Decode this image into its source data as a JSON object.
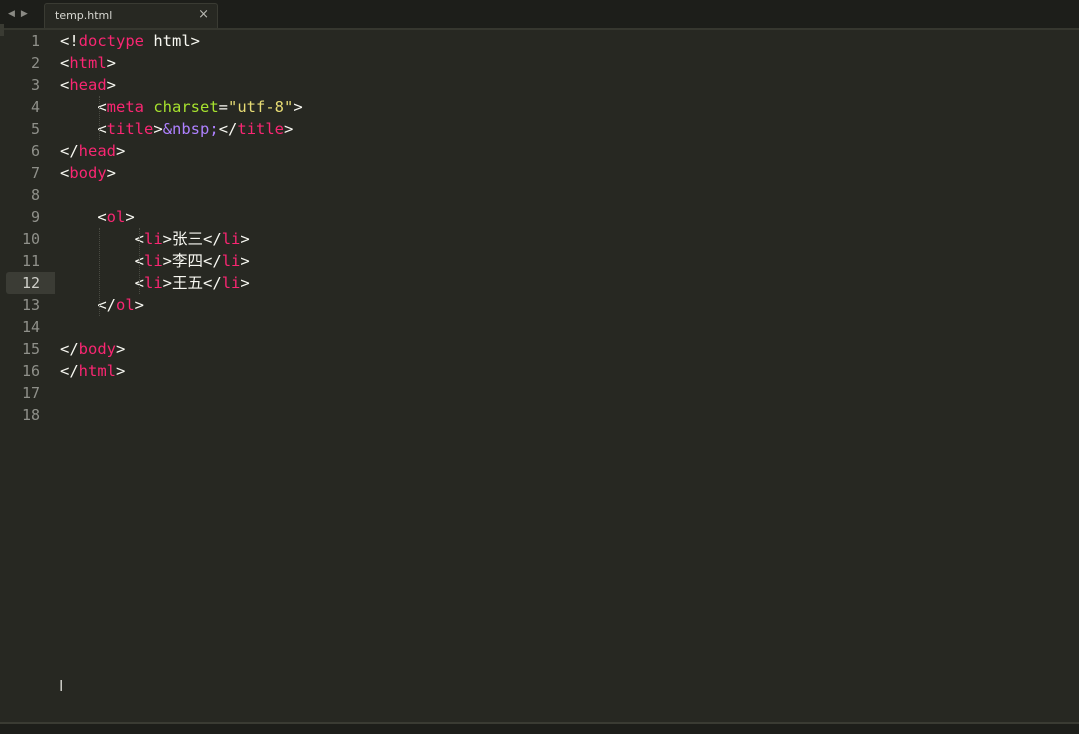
{
  "tabbar": {
    "nav_prev": "◀",
    "nav_next": "▶",
    "tab": {
      "title": "temp.html",
      "close": "×"
    }
  },
  "editor": {
    "active_line": 12,
    "line_numbers": [
      "1",
      "2",
      "3",
      "4",
      "5",
      "6",
      "7",
      "8",
      "9",
      "10",
      "11",
      "12",
      "13",
      "14",
      "15",
      "16",
      "17",
      "18"
    ],
    "lines": [
      "<!doctype html>",
      "<html>",
      "<head>",
      "    <meta charset=\"utf-8\">",
      "    <title>&nbsp;</title>",
      "</head>",
      "<body>",
      "",
      "    <ol>",
      "        <li>张三</li>",
      "        <li>李四</li>",
      "        <li>王五</li>",
      "    </ol>",
      "",
      "</body>",
      "</html>",
      "",
      ""
    ]
  },
  "colors": {
    "background": "#272822",
    "tag": "#f92672",
    "attribute": "#a6e22e",
    "string": "#e6db74",
    "entity": "#ae81ff",
    "text": "#f8f8f2",
    "gutter": "#8f908a"
  },
  "icons": [
    "nav-prev-icon",
    "nav-next-icon",
    "tab-close-icon",
    "text-cursor-icon"
  ]
}
